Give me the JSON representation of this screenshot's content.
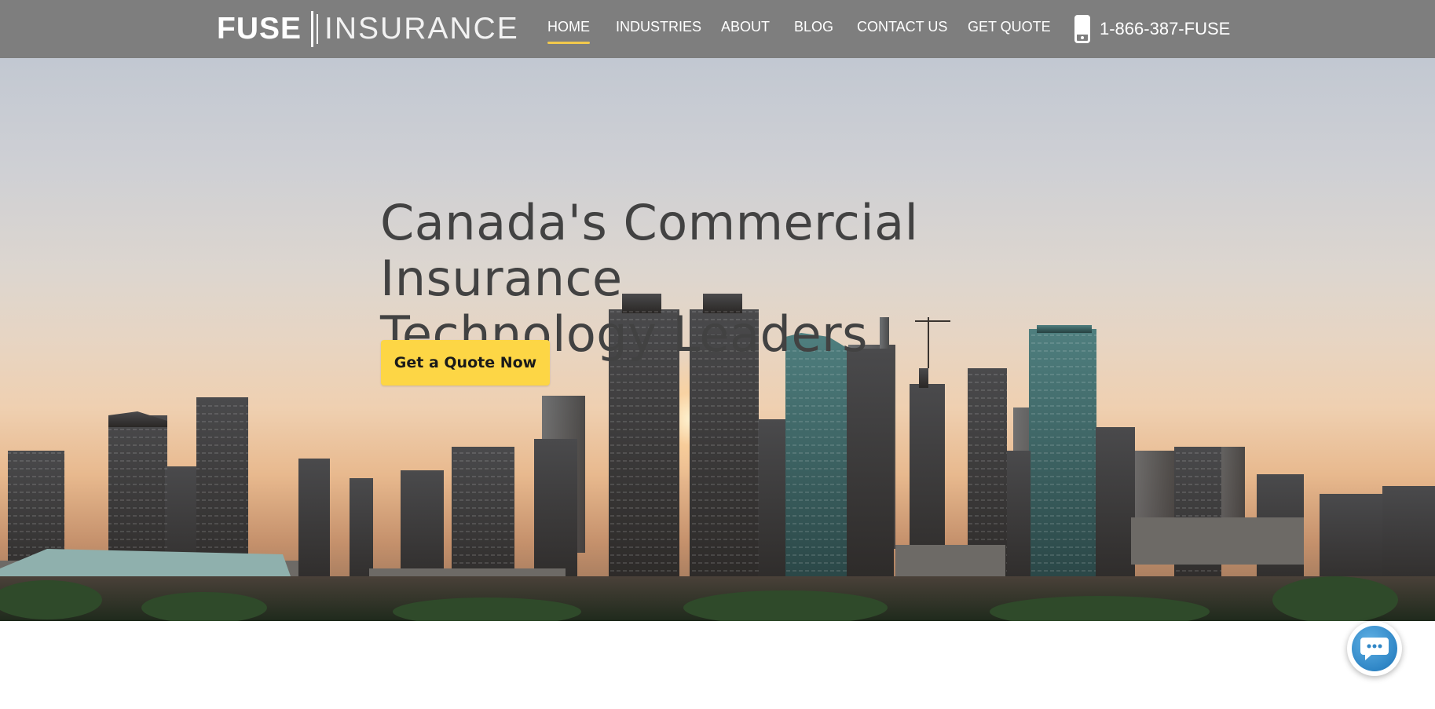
{
  "brand": {
    "name_bold": "FUSE",
    "name_light": "INSURANCE"
  },
  "nav": {
    "items": [
      {
        "label": "HOME",
        "active": true
      },
      {
        "label": "INDUSTRIES",
        "active": false
      },
      {
        "label": "ABOUT",
        "active": false
      },
      {
        "label": "BLOG",
        "active": false
      },
      {
        "label": "CONTACT US",
        "active": false
      },
      {
        "label": "GET QUOTE",
        "active": false
      }
    ],
    "phone": "1-866-387-FUSE",
    "phone_icon": "mobile-phone-icon"
  },
  "hero": {
    "title_line1": "Canada's Commercial Insurance",
    "title_line2": "Technology Leaders",
    "cta_label": "Get a Quote Now",
    "background": "city-skyline-sunset"
  },
  "chat": {
    "icon": "chat-bubble-icon"
  },
  "colors": {
    "header_bg": "#7e7e7e",
    "accent": "#fdd645",
    "nav_active_underline": "#f2c94c",
    "title_text": "#424242",
    "chat_blue": "#2f86c6"
  }
}
